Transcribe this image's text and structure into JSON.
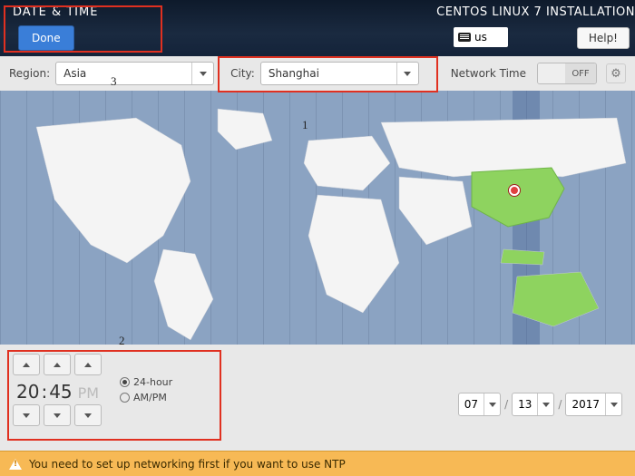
{
  "header": {
    "page_title": "DATE & TIME",
    "done_label": "Done",
    "install_title": "CENTOS LINUX 7 INSTALLATION",
    "kb_layout": "us",
    "help_label": "Help!"
  },
  "selectors": {
    "region_label": "Region:",
    "region_value": "Asia",
    "city_label": "City:",
    "city_value": "Shanghai",
    "network_time_label": "Network Time",
    "network_time_off": "OFF"
  },
  "annotations": {
    "a1": "1",
    "a2": "2",
    "a3": "3"
  },
  "time": {
    "hh": "20",
    "mm": "45",
    "ampm": "PM",
    "fmt_24": "24-hour",
    "fmt_ampm": "AM/PM",
    "selected_fmt": "24"
  },
  "date": {
    "month": "07",
    "day": "13",
    "year": "2017"
  },
  "warning": "You need to set up networking first if you want to use NTP"
}
